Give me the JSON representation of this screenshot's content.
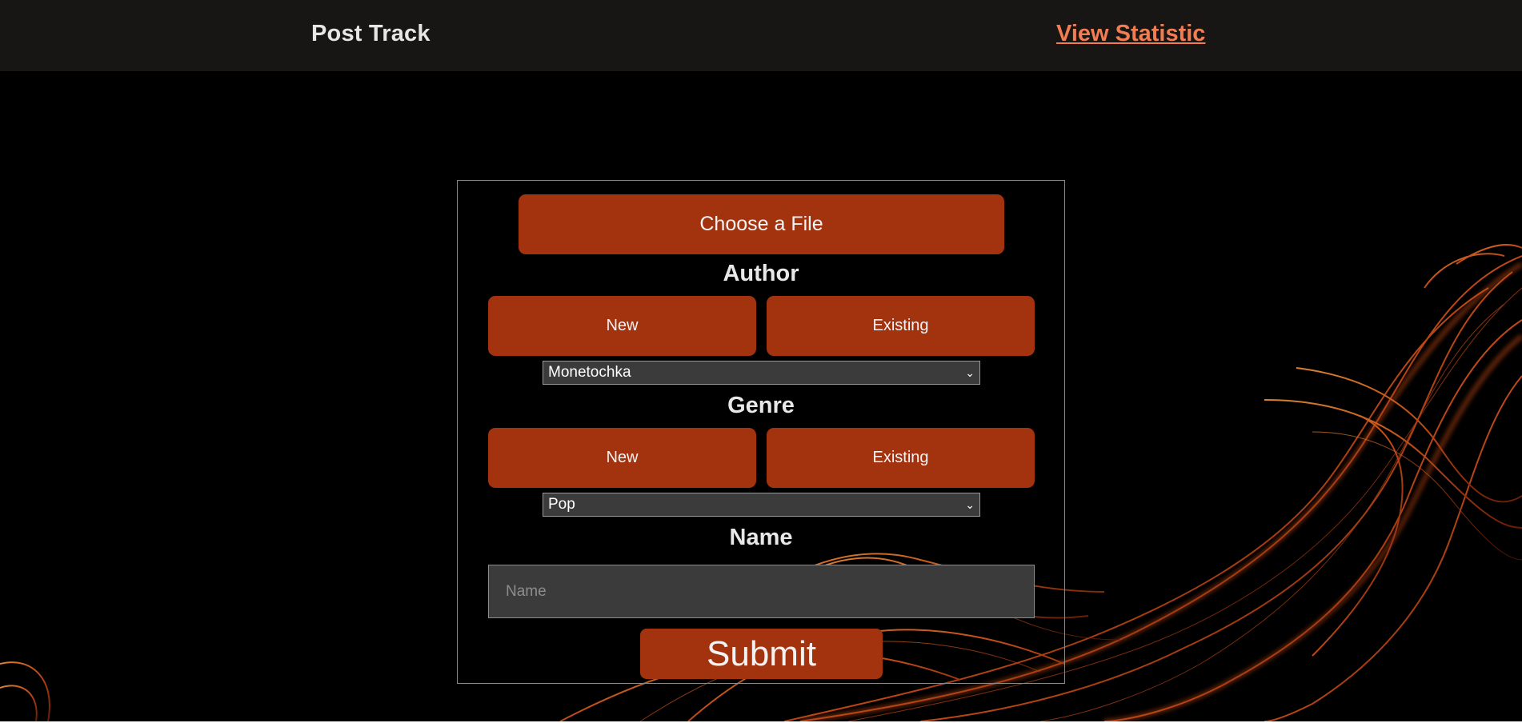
{
  "header": {
    "brand": "Post Track",
    "statistic_link": "View Statistic"
  },
  "form": {
    "file_button": "Choose a File",
    "author": {
      "heading": "Author",
      "new_label": "New",
      "existing_label": "Existing",
      "selected": "Monetochka"
    },
    "genre": {
      "heading": "Genre",
      "new_label": "New",
      "existing_label": "Existing",
      "selected": "Pop"
    },
    "name": {
      "heading": "Name",
      "placeholder": "Name"
    },
    "submit_label": "Submit"
  },
  "colors": {
    "navbar": "#171614",
    "accent_button": "#a3330f",
    "link": "#f27d52",
    "background": "#000000",
    "input_bg": "#3b3b3b"
  },
  "icons": {
    "select_chevron": "chevron-down-icon"
  }
}
